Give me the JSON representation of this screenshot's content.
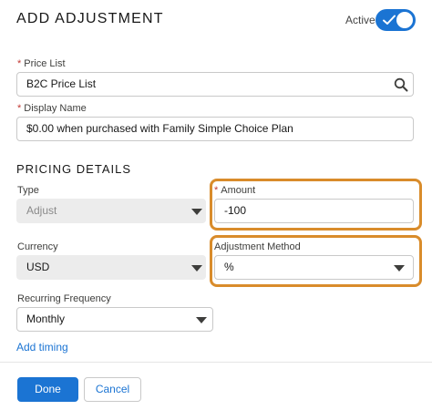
{
  "header": {
    "title": "ADD ADJUSTMENT",
    "active_label": "Active",
    "active_toggle_on": true
  },
  "fields": {
    "price_list": {
      "label": "Price List",
      "required_mark": "*",
      "value": "B2C Price List"
    },
    "display_name": {
      "label": "Display Name",
      "required_mark": "*",
      "value": "$0.00 when purchased with Family Simple Choice Plan"
    }
  },
  "pricing": {
    "section_title": "PRICING DETAILS",
    "type": {
      "label": "Type",
      "value": "Adjust"
    },
    "amount": {
      "label": "Amount",
      "required_mark": "*",
      "value": "-100"
    },
    "currency": {
      "label": "Currency",
      "value": "USD"
    },
    "adjustment_method": {
      "label": "Adjustment Method",
      "value": "%"
    },
    "recurring_frequency": {
      "label": "Recurring Frequency",
      "value": "Monthly"
    },
    "add_timing_label": "Add timing"
  },
  "footer": {
    "done_label": "Done",
    "cancel_label": "Cancel"
  },
  "colors": {
    "brand": "#1b74d3",
    "highlight": "#d98c2b",
    "required": "#c23934"
  },
  "icons": [
    "checkmark-icon",
    "search-icon",
    "chevron-down-icon"
  ]
}
